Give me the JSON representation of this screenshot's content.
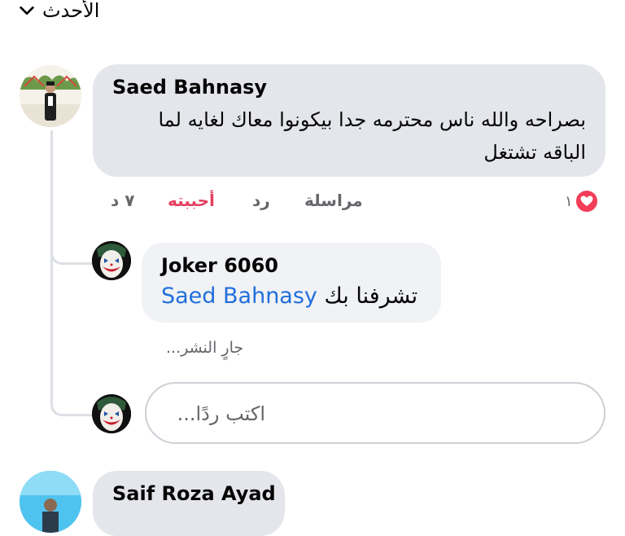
{
  "sort": {
    "label": "الأحدث",
    "icon": "chevron-down-icon"
  },
  "comments": [
    {
      "author": "Saed Bahnasy",
      "text": "بصراحه والله ناس محترمه جدا بيكونوا معاك لغايه لما الباقه تشتغل",
      "actions": {
        "time": "٧ د",
        "like": "أحببته",
        "reply": "رد",
        "message": "مراسلة"
      },
      "reactions": {
        "count": "١",
        "icon": "heart-reaction-icon",
        "color": "#f33e58"
      },
      "replies": [
        {
          "author": "Joker 6060",
          "text": "تشرفنا بك",
          "mention": "Saed Bahnasy",
          "status": "جارٍ النشر..."
        }
      ],
      "reply_input": {
        "placeholder": "اكتب ردًا..."
      }
    },
    {
      "author": "Saif Roza Ayad"
    }
  ],
  "colors": {
    "liked": "#e4405f",
    "mention": "#216fdb",
    "thread_line": "#dcdfe4",
    "bubble": "#e4e6eb"
  }
}
